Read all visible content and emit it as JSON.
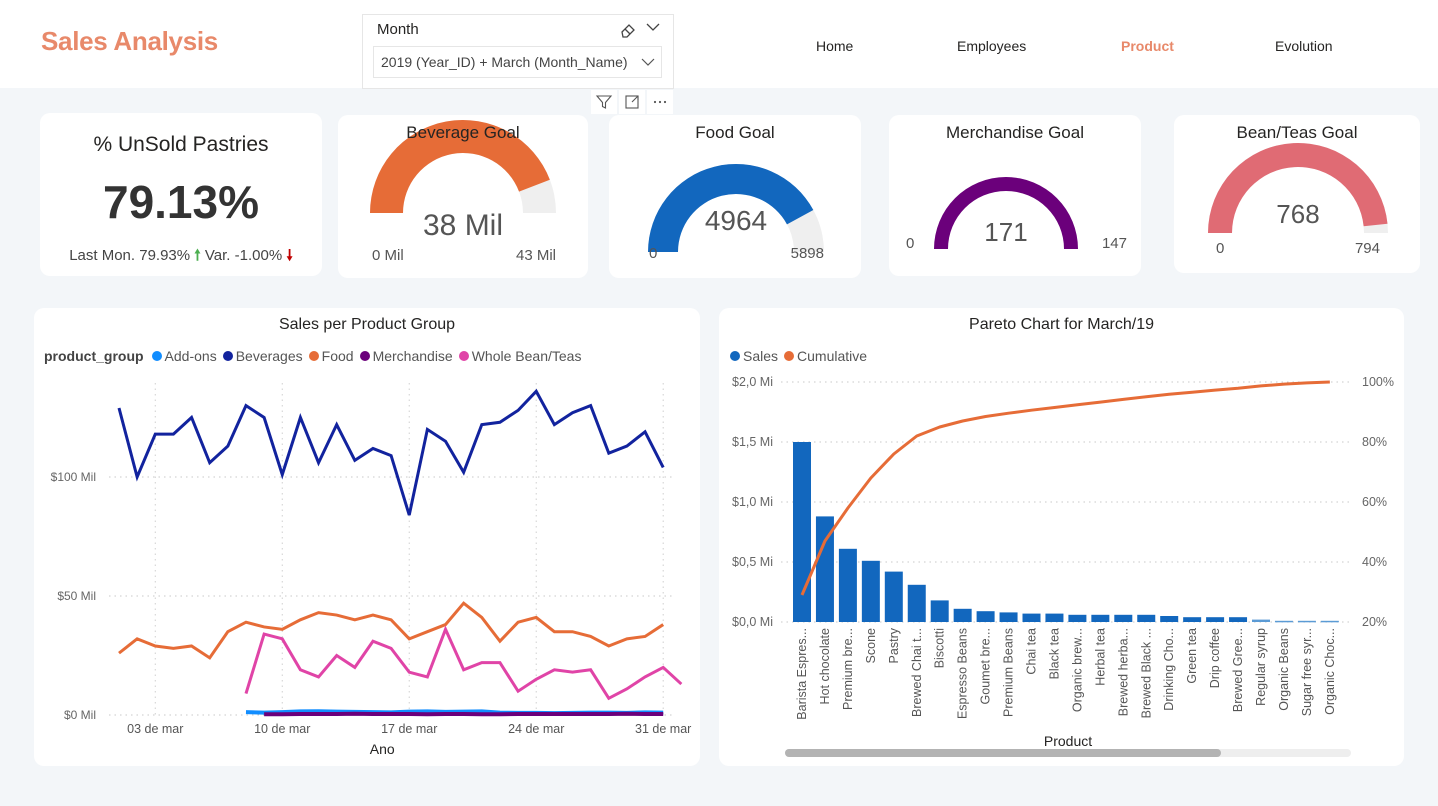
{
  "header": {
    "title": "Sales Analysis",
    "nav": [
      {
        "label": "Home",
        "active": false
      },
      {
        "label": "Employees",
        "active": false
      },
      {
        "label": "Product",
        "active": true
      },
      {
        "label": "Evolution",
        "active": false
      }
    ]
  },
  "slicer": {
    "label": "Month",
    "value": "2019 (Year_ID) + March (Month_Name)",
    "icons": [
      "eraser-icon",
      "chevron-down-icon"
    ]
  },
  "visual_toolbar": [
    "filter-icon",
    "focus-mode-icon",
    "more-options-icon"
  ],
  "kpi": {
    "title": "% UnSold Pastries",
    "value": "79.13%",
    "last_label": "Last Mon. 79.93%",
    "var_label": "Var. -1.00%"
  },
  "gauges": [
    {
      "title": "Beverage Goal",
      "value": 38,
      "value_label": "38 Mil",
      "min_label": "0 Mil",
      "max_label": "43 Mil",
      "max": 43,
      "color": "#e66c37"
    },
    {
      "title": "Food Goal",
      "value": 4964,
      "value_label": "4964",
      "min_label": "0",
      "max_label": "5898",
      "max": 5898,
      "color": "#1267be"
    },
    {
      "title": "Merchandise Goal",
      "value": 171,
      "value_label": "171",
      "min_label": "0",
      "max_label": "147",
      "max": 147,
      "color": "#6b007b"
    },
    {
      "title": "Bean/Teas Goal",
      "value": 768,
      "value_label": "768",
      "min_label": "0",
      "max_label": "794",
      "max": 794,
      "color": "#e06b74"
    }
  ],
  "chart_data": [
    {
      "type": "line",
      "title": "Sales per Product Group",
      "legend_title": "product_group",
      "legend_position": "top-left",
      "xlabel": "Ano",
      "ylabel": "",
      "x": [
        1,
        2,
        3,
        4,
        5,
        6,
        7,
        8,
        9,
        10,
        11,
        12,
        13,
        14,
        15,
        16,
        17,
        18,
        19,
        20,
        21,
        22,
        23,
        24,
        25,
        26,
        27,
        28,
        29,
        30,
        31
      ],
      "x_ticks": [
        {
          "day": 3,
          "label": "03 de mar"
        },
        {
          "day": 10,
          "label": "10 de mar"
        },
        {
          "day": 17,
          "label": "17 de mar"
        },
        {
          "day": 24,
          "label": "24 de mar"
        },
        {
          "day": 31,
          "label": "31 de mar"
        }
      ],
      "y_ticks": [
        {
          "value": 0,
          "label": "$0 Mil"
        },
        {
          "value": 50,
          "label": "$50 Mil"
        },
        {
          "value": 100,
          "label": "$100 Mil"
        }
      ],
      "ylim": [
        0,
        135
      ],
      "grid": true,
      "series": [
        {
          "name": "Add-ons",
          "color": "#118dff",
          "start_day": 8,
          "values": [
            1.2,
            1.0,
            1.2,
            1.5,
            1.6,
            1.4,
            1.3,
            1.2,
            1.1,
            1.4,
            1.5,
            1.3,
            1.4,
            1.5,
            1.0,
            0.9,
            0.9,
            0.8,
            0.9,
            1.0,
            1.0,
            0.9,
            1.1,
            1.0
          ]
        },
        {
          "name": "Beverages",
          "color": "#12239e",
          "start_day": 1,
          "values": [
            129,
            100,
            118,
            118,
            125,
            106,
            113,
            130,
            125,
            101,
            125,
            106,
            122,
            107,
            112,
            109,
            84,
            120,
            115,
            102,
            122,
            123,
            128,
            136,
            122,
            127,
            130,
            110,
            113,
            119,
            104
          ]
        },
        {
          "name": "Food",
          "color": "#e66c37",
          "start_day": 1,
          "values": [
            26,
            32,
            29,
            28,
            29,
            24,
            35,
            39,
            37,
            36,
            40,
            43,
            42,
            40,
            42,
            40,
            32,
            35,
            38,
            47,
            41,
            31,
            39,
            41,
            35,
            35,
            33,
            29,
            32,
            33,
            38
          ]
        },
        {
          "name": "Merchandise",
          "color": "#6b007b",
          "start_day": 9,
          "values": [
            0.3,
            0.3,
            0.4,
            0.4,
            0.4,
            0.5,
            0.4,
            0.4,
            0.4,
            0.3,
            0.4,
            0.4,
            0.3,
            0.3,
            0.4,
            0.4,
            0.4,
            0.4,
            0.4,
            0.4,
            0.5,
            0.4,
            0.4
          ]
        },
        {
          "name": "Whole Bean/Teas",
          "color": "#e044a7",
          "start_day": 8,
          "values": [
            9,
            34,
            32,
            19,
            16,
            25,
            20,
            31,
            28,
            18,
            16,
            36,
            19,
            22,
            22,
            10,
            15,
            19,
            18,
            19,
            7,
            11,
            16,
            20,
            13
          ]
        }
      ]
    },
    {
      "type": "bar",
      "title": "Pareto Chart for March/19",
      "legend_position": "top-left",
      "xlabel": "Product",
      "ylabel": "",
      "categories": [
        "Barista Espres...",
        "Hot chocolate",
        "Premium bre...",
        "Scone",
        "Pastry",
        "Brewed Chai t...",
        "Biscotti",
        "Espresso Beans",
        "Goumet bre...",
        "Premium Beans",
        "Chai tea",
        "Black tea",
        "Organic brew...",
        "Herbal tea",
        "Brewed herba...",
        "Brewed Black ...",
        "Drinking Cho...",
        "Green tea",
        "Drip coffee",
        "Brewed Gree...",
        "Regular syrup",
        "Organic Beans",
        "Sugar free syr...",
        "Organic Choc..."
      ],
      "y_ticks_left": [
        "$0,0 Mi",
        "$0,5 Mi",
        "$1,0 Mi",
        "$1,5 Mi",
        "$2,0 Mi"
      ],
      "y_ticks_right": [
        "20%",
        "40%",
        "60%",
        "80%",
        "100%"
      ],
      "ylim": [
        0,
        2.0
      ],
      "y2lim": [
        20,
        100
      ],
      "grid": true,
      "series": [
        {
          "name": "Sales",
          "type": "bar",
          "color": "#1267be",
          "values": [
            1.5,
            0.88,
            0.61,
            0.51,
            0.42,
            0.31,
            0.18,
            0.11,
            0.09,
            0.08,
            0.07,
            0.07,
            0.06,
            0.06,
            0.06,
            0.06,
            0.05,
            0.04,
            0.04,
            0.04,
            0.02,
            0.01,
            0.01,
            0.01
          ]
        },
        {
          "name": "Cumulative",
          "type": "line",
          "color": "#e66c37",
          "values": [
            29,
            47,
            58,
            68,
            76,
            82,
            85,
            87,
            88.5,
            89.6,
            90.6,
            91.5,
            92.4,
            93.3,
            94.2,
            95.1,
            95.9,
            96.6,
            97.3,
            97.9,
            98.7,
            99.3,
            99.7,
            100
          ]
        }
      ]
    }
  ]
}
